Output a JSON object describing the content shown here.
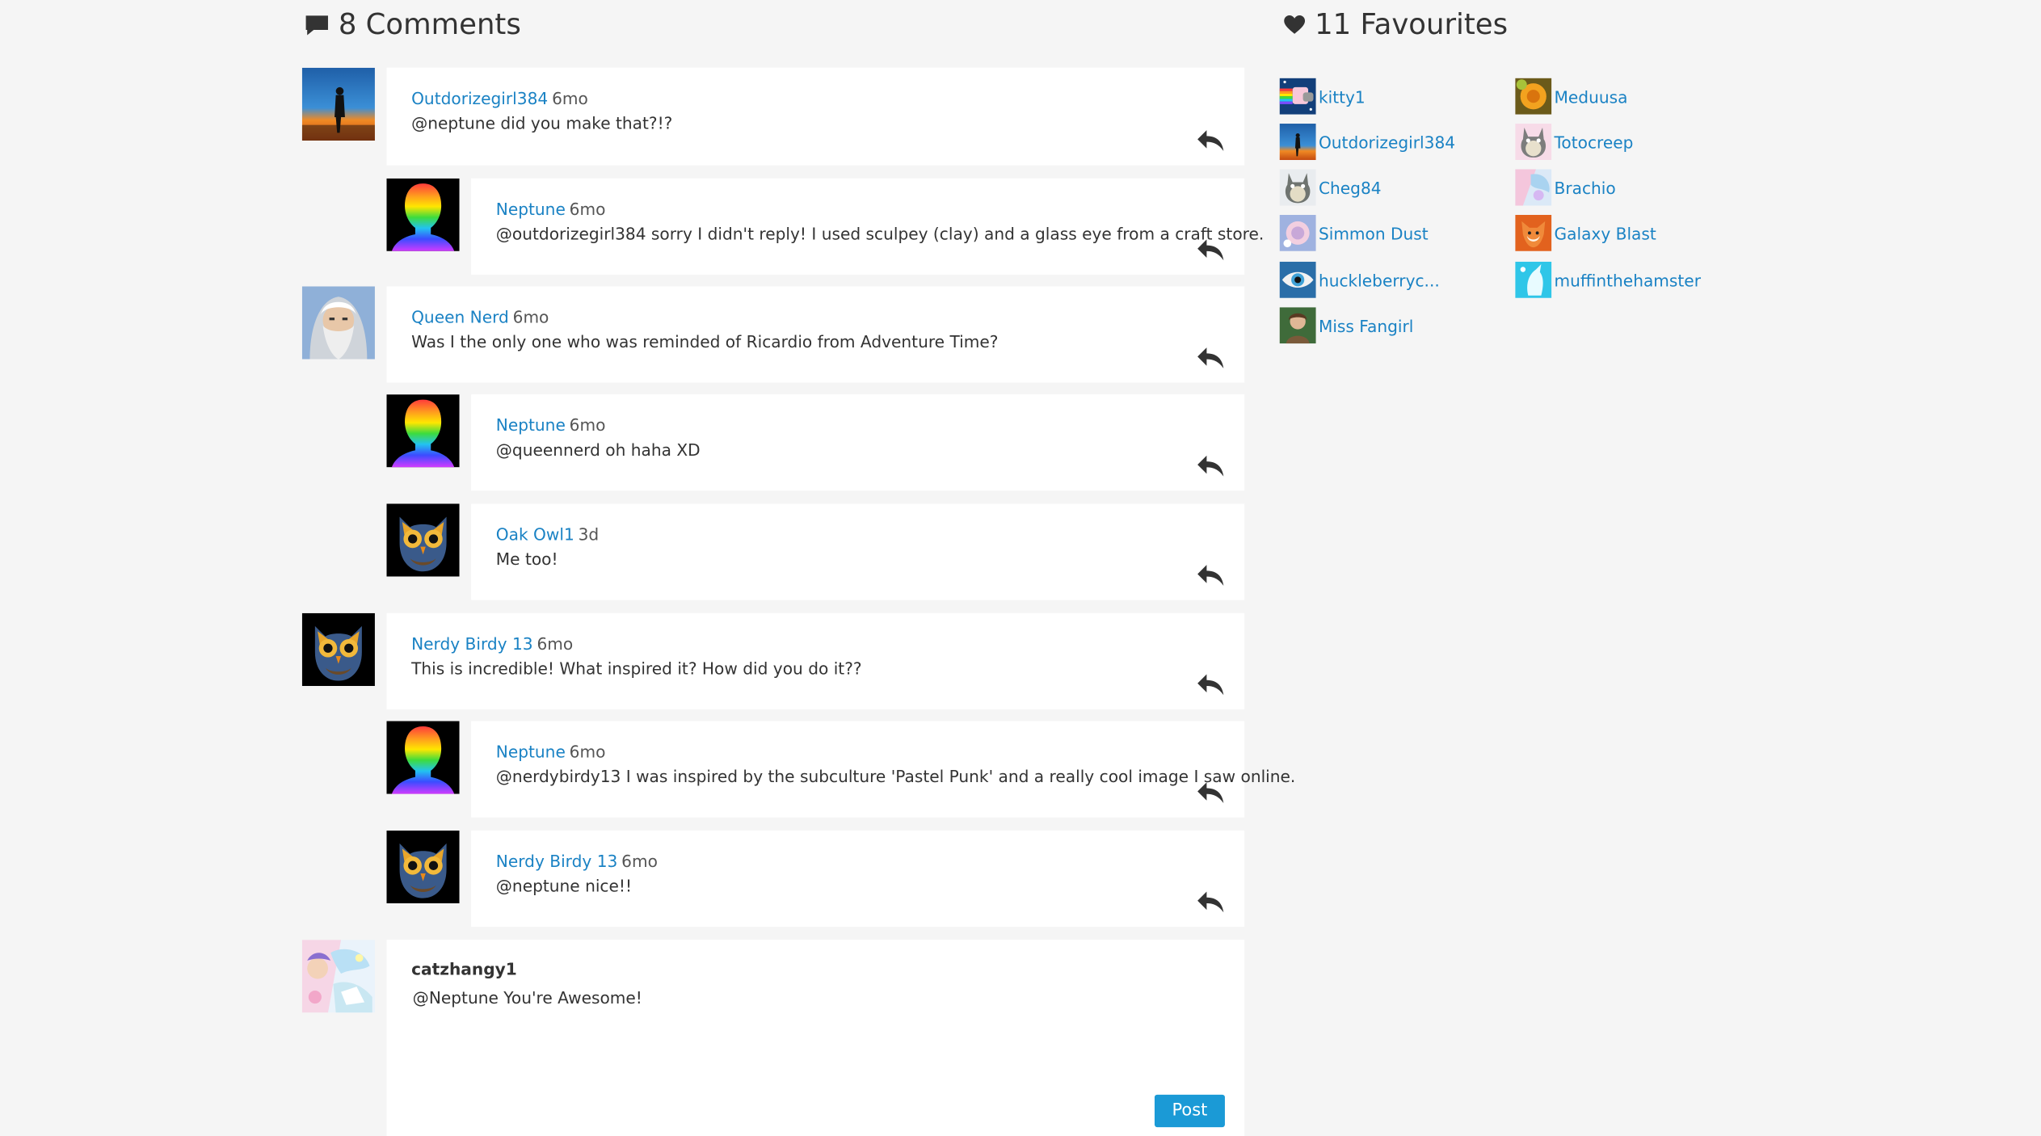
{
  "comments_header": {
    "count_label": "8 Comments",
    "icon": "comment-icon"
  },
  "favourites_header": {
    "count_label": "11 Favourites",
    "icon": "heart-icon"
  },
  "comments": [
    {
      "user": "Outdorizegirl384",
      "time": "6mo",
      "text": "@neptune did you make that?!?",
      "avatar": "silhouette-sunset"
    },
    {
      "user": "Neptune",
      "time": "6mo",
      "text": "@outdorizegirl384 sorry I didn't reply! I used sculpey (clay) and a glass eye from a craft store.",
      "avatar": "rainbow-head"
    },
    {
      "user": "Queen Nerd",
      "time": "6mo",
      "text": "Was I the only one who was reminded of Ricardio from Adventure Time?",
      "avatar": "wizard"
    },
    {
      "user": "Neptune",
      "time": "6mo",
      "text": "@queennerd oh haha XD",
      "avatar": "rainbow-head"
    },
    {
      "user": "Oak Owl1",
      "time": "3d",
      "text": "Me too!",
      "avatar": "owl"
    },
    {
      "user": "Nerdy Birdy 13",
      "time": "6mo",
      "text": "This is incredible! What inspired it? How did you do it??",
      "avatar": "owl"
    },
    {
      "user": "Neptune",
      "time": "6mo",
      "text": "@nerdybirdy13 I was inspired by the subculture 'Pastel Punk' and a really cool image I saw online.",
      "avatar": "rainbow-head"
    },
    {
      "user": "Nerdy Birdy 13",
      "time": "6mo",
      "text": "@neptune nice!!",
      "avatar": "owl"
    }
  ],
  "compose": {
    "user": "catzhangy1",
    "value": "@Neptune You're Awesome!",
    "post_label": "Post",
    "avatar": "pastel-art"
  },
  "favourites": [
    {
      "name": "kitty1",
      "avatar": "nyan"
    },
    {
      "name": "Meduusa",
      "avatar": "orange-flower"
    },
    {
      "name": "Outdorizegirl384",
      "avatar": "silhouette-sunset"
    },
    {
      "name": "Totocreep",
      "avatar": "totoro-pink"
    },
    {
      "name": "Cheg84",
      "avatar": "totoro-gray"
    },
    {
      "name": "Brachio",
      "avatar": "pastel-swirl"
    },
    {
      "name": "Simmon Dust",
      "avatar": "pastel-blue"
    },
    {
      "name": "Galaxy Blast",
      "avatar": "fox"
    },
    {
      "name": "huckleberryc...",
      "avatar": "eye"
    },
    {
      "name": "muffinthehamster",
      "avatar": "cyan-unicorn"
    },
    {
      "name": "Miss Fangirl",
      "avatar": "girl-green"
    }
  ],
  "colors": {
    "link": "#1a82c4",
    "post_button": "#1b9ad6",
    "background": "#f5f5f5",
    "card": "#ffffff"
  }
}
